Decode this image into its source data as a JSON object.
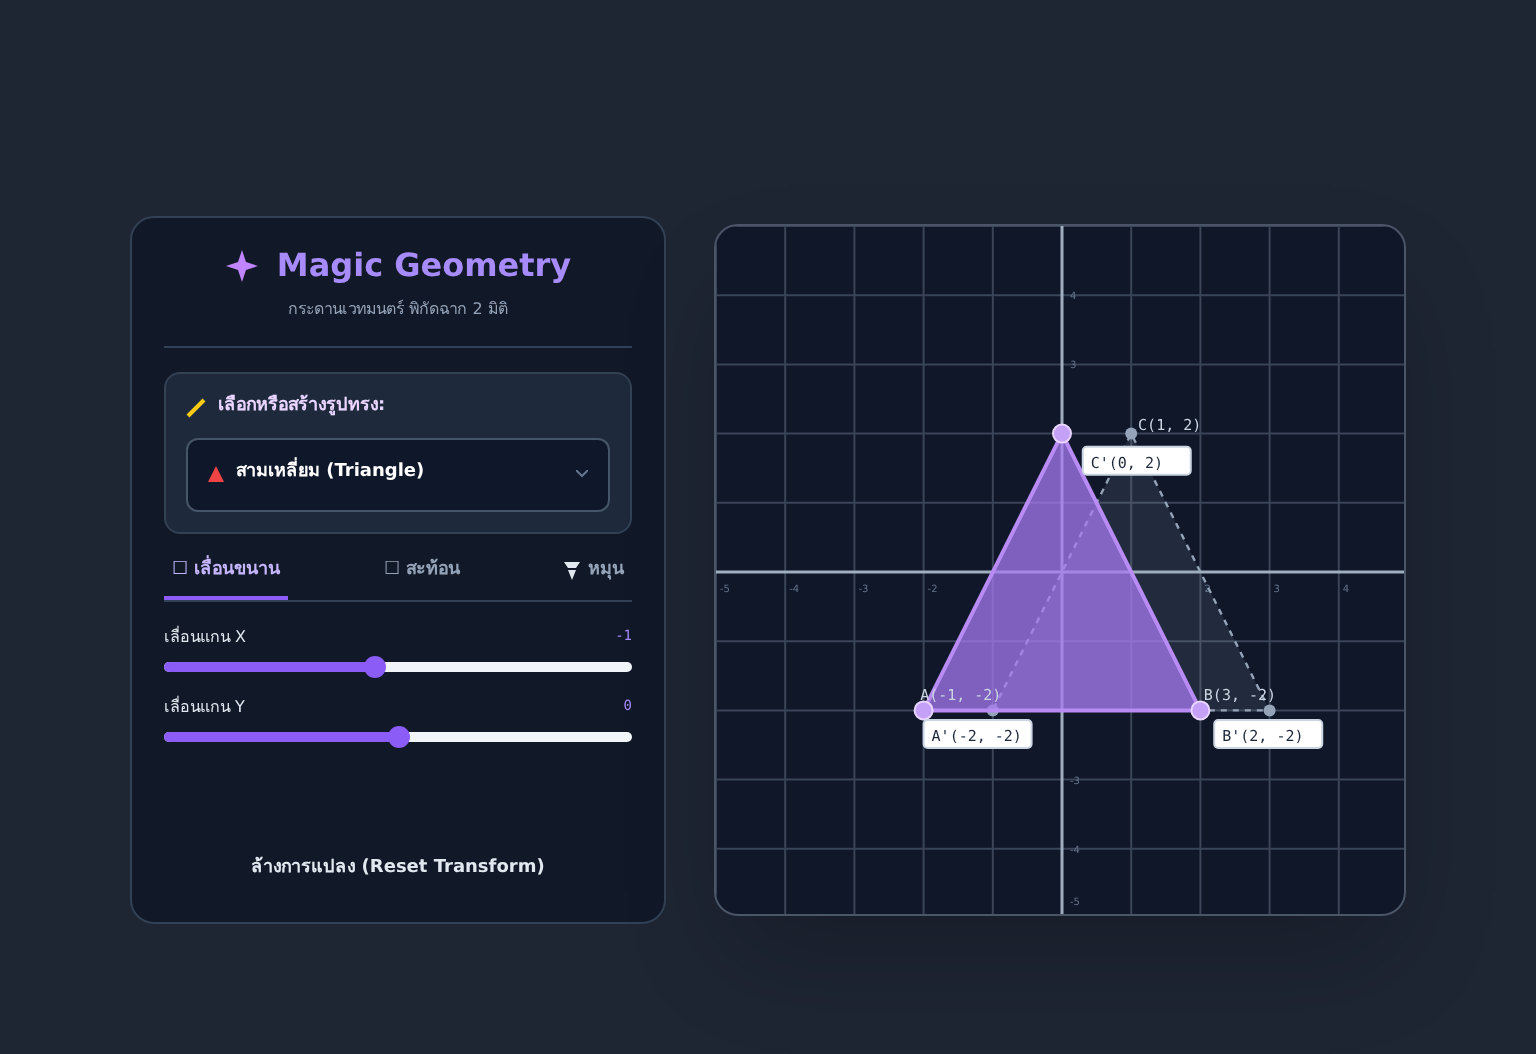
{
  "panel": {
    "title": "Magic Geometry",
    "subtitle": "กระดานเวทมนตร์ พิกัดฉาก 2 มิติ",
    "shape_picker": {
      "label": "เลือกหรือสร้างรูปทรง:",
      "value": "สามเหลี่ยม (Triangle)"
    },
    "tabs": [
      {
        "label": "☐ เลื่อนขนาน",
        "selected": true,
        "kind": "box"
      },
      {
        "label": "☐ สะท้อน",
        "selected": false,
        "kind": "box"
      },
      {
        "label": "หมุน",
        "selected": false,
        "kind": "spin"
      }
    ],
    "sliders": [
      {
        "label": "เลื่อนแกน X",
        "reading": "-1",
        "level": 0.45
      },
      {
        "label": "เลื่อนแกน Y",
        "reading": "0",
        "level": 0.5
      }
    ],
    "reset_button": "ล้างการแปลง (Reset Transform)"
  },
  "plane": {
    "x_ticks": [
      "-5",
      "-4",
      "-3",
      "-2",
      "2",
      "3",
      "4"
    ],
    "y_ticks": [
      "4",
      "3",
      "-3",
      "-4",
      "-5"
    ],
    "original_labels": [
      "A(-1, -2)",
      "B(3, -2)",
      "C(1, 2)"
    ],
    "image_labels": [
      "A'(-2, -2)",
      "B'(2, -2)",
      "C'(0, 2)"
    ]
  }
}
